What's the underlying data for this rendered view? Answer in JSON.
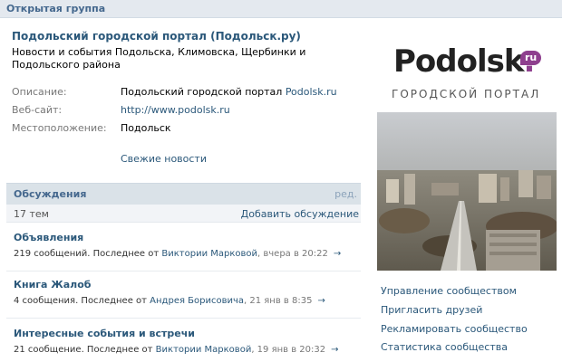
{
  "header": {
    "label": "Открытая группа"
  },
  "group": {
    "title": "Подольский городской портал (Подольск.ру)",
    "status": "Новости и события Подольска, Климовска, Щербинки и Подольского района"
  },
  "info": {
    "description": {
      "label": "Описание:",
      "text": "Подольский городской портал ",
      "link": "Podolsk.ru"
    },
    "website": {
      "label": "Веб-сайт:",
      "value": "http://www.podolsk.ru"
    },
    "location": {
      "label": "Местоположение:",
      "value": "Подольск"
    }
  },
  "fresh_news": "Свежие новости",
  "discussions": {
    "title": "Обсуждения",
    "edit": "ред.",
    "count": "17 тем",
    "add": "Добавить обсуждение",
    "topics": [
      {
        "title": "Объявления",
        "prefix": "219 сообщений. Последнее от ",
        "author": "Виктории Марковой",
        "date": ", вчера в 20:22",
        "arrow": "→"
      },
      {
        "title": "Книга Жалоб",
        "prefix": "4 сообщения. Последнее от ",
        "author": "Андрея Борисовича",
        "date": ", 21 янв в 8:35",
        "arrow": "→"
      },
      {
        "title": "Интересные события и встречи",
        "prefix": "21 сообщение. Последнее от ",
        "author": "Виктории Марковой",
        "date": ", 19 янв в 20:32",
        "arrow": "→"
      }
    ]
  },
  "logo": {
    "word": "Podolsk",
    "dot": ".",
    "badge": "ru",
    "subtitle": "ГОРОДСКОЙ ПОРТАЛ"
  },
  "menu": [
    "Управление сообществом",
    "Пригласить друзей",
    "Рекламировать сообщество",
    "Статистика сообщества"
  ],
  "colors": {
    "link": "#2b587a",
    "accent": "#8e3f8e",
    "header_bg": "#e4e9ef"
  }
}
